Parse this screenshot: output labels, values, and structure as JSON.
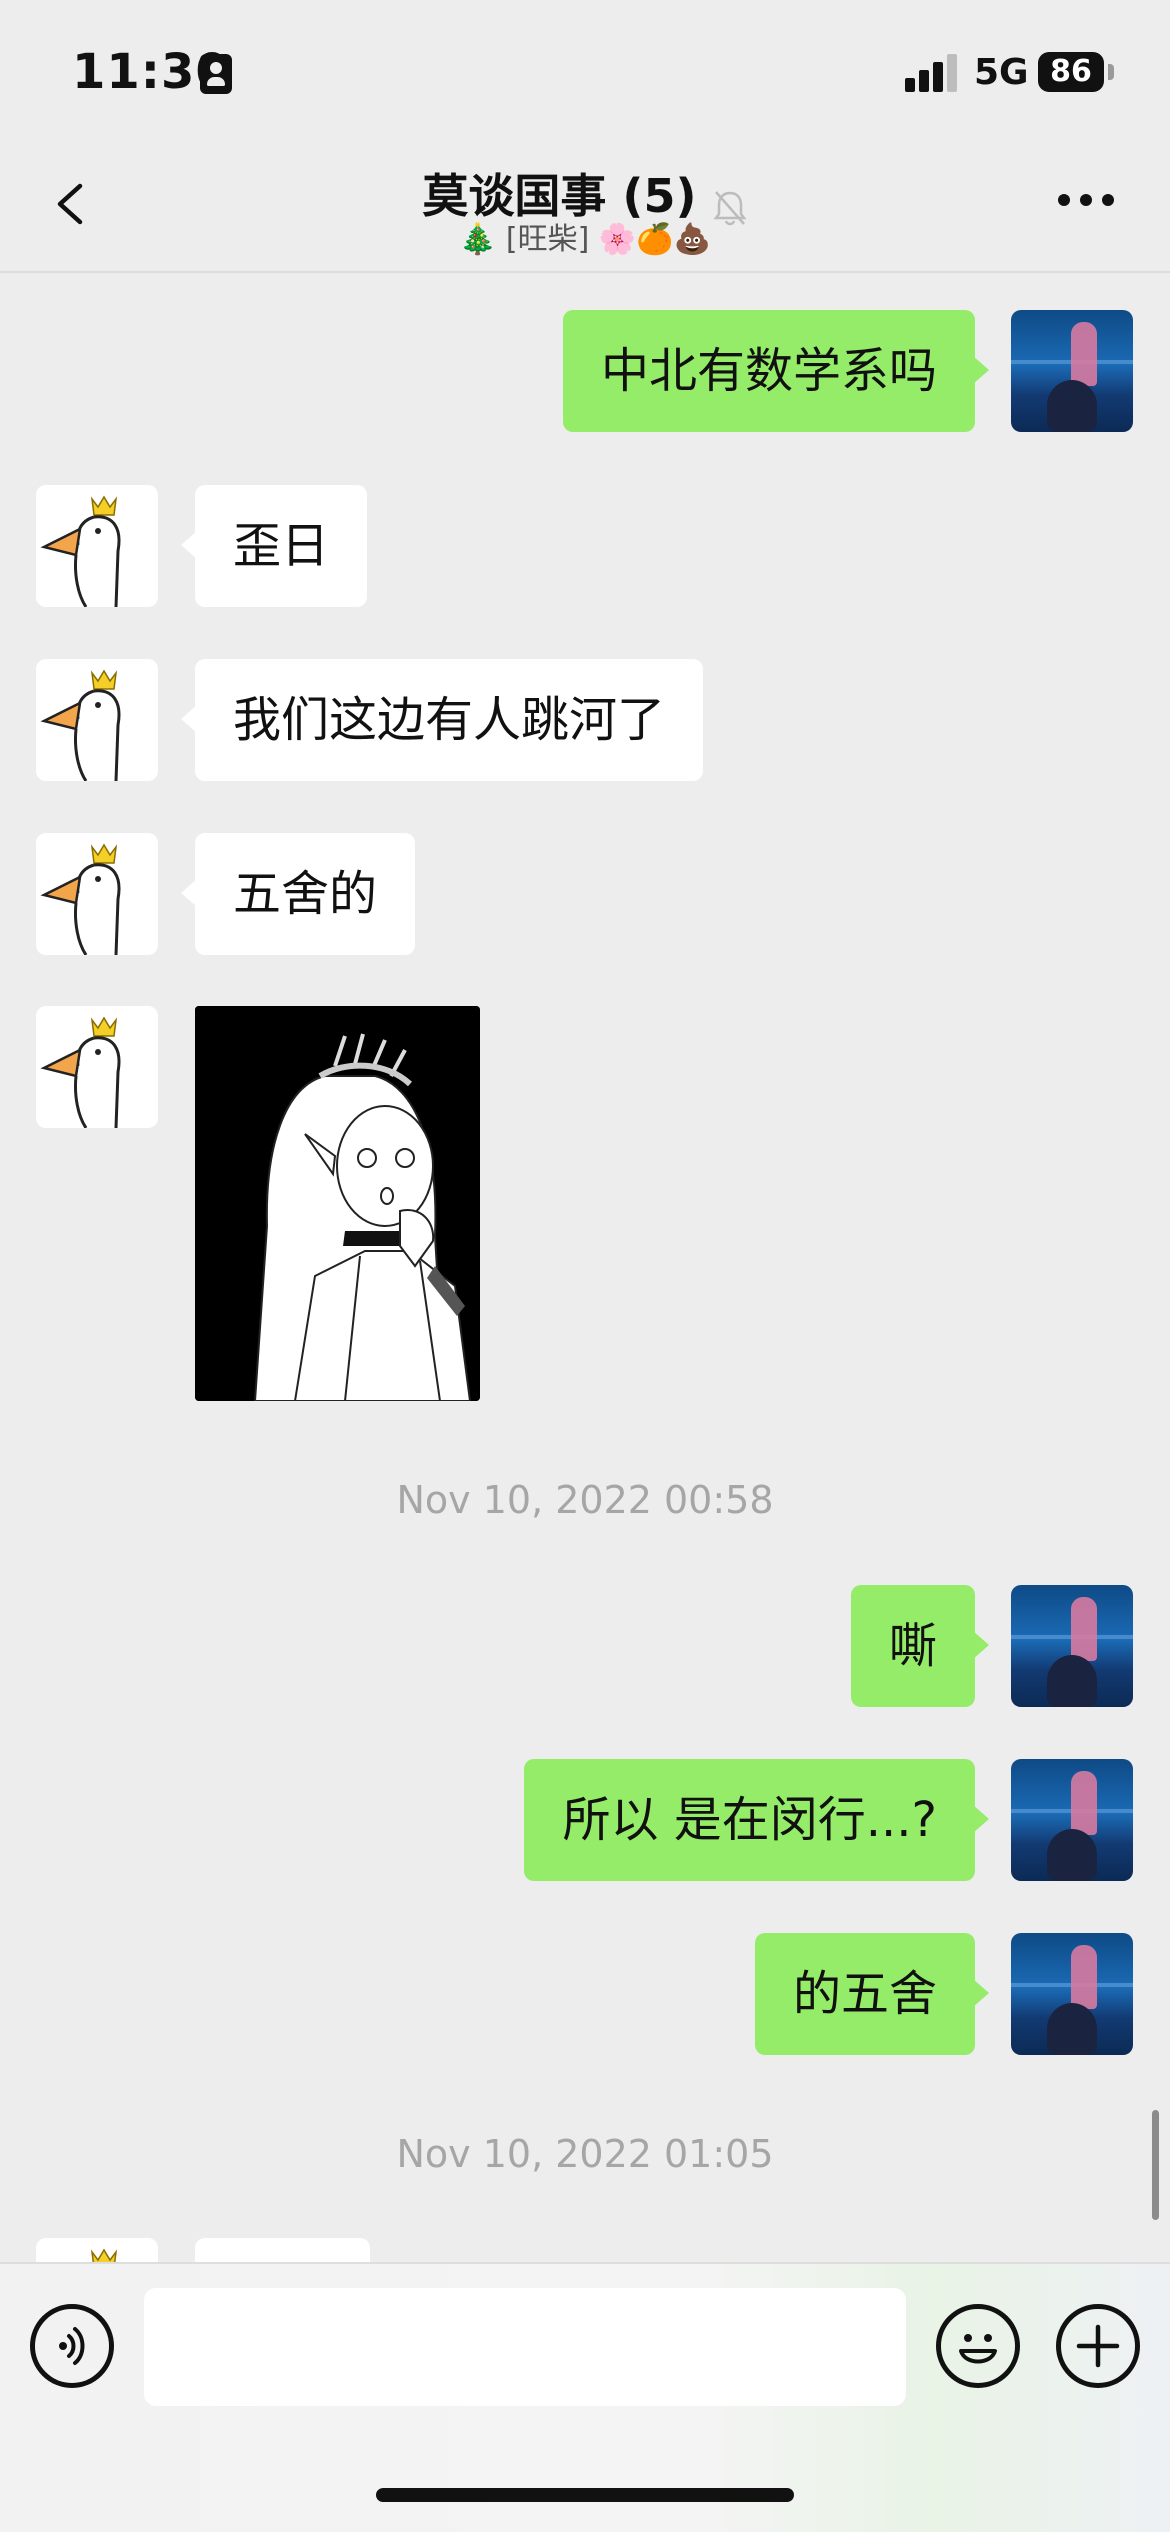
{
  "status_bar": {
    "time": "11:30",
    "network": "5G",
    "battery": "86"
  },
  "header": {
    "title": "莫谈国事 (5)",
    "subtitle": "🎄 [旺柴] 🌸🍊💩"
  },
  "messages": [
    {
      "side": "out",
      "text": "中北有数学系吗"
    },
    {
      "side": "in",
      "text": "歪日"
    },
    {
      "side": "in",
      "text": "我们这边有人跳河了"
    },
    {
      "side": "in",
      "text": "五舍的"
    },
    {
      "side": "in",
      "type": "image",
      "icon": "manga-sticker-image"
    },
    {
      "type": "timestamp",
      "text": "Nov 10, 2022 00:58"
    },
    {
      "side": "out",
      "text": "嘶"
    },
    {
      "side": "out",
      "text": "所以 是在闵行...?"
    },
    {
      "side": "out",
      "text": "的五舍"
    },
    {
      "type": "timestamp",
      "text": "Nov 10, 2022 01:05"
    }
  ],
  "input": {
    "value": "",
    "placeholder": ""
  },
  "colors": {
    "outgoing_bubble": "#95ec69",
    "incoming_bubble": "#ffffff",
    "background": "#ededed"
  }
}
